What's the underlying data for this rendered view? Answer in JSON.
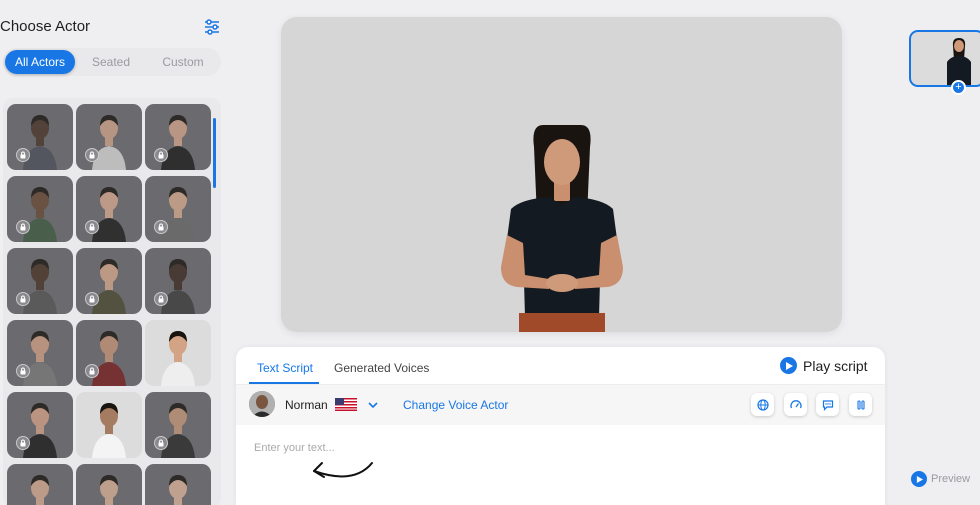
{
  "left_panel": {
    "title": "Choose Actor",
    "filter_icon": "sliders-icon",
    "tabs": [
      {
        "label": "All Actors",
        "active": true
      },
      {
        "label": "Seated",
        "active": false
      },
      {
        "label": "Custom",
        "active": false
      }
    ],
    "actors": [
      {
        "locked": true,
        "skin": "#4a3428",
        "cloth": "#4b4f58",
        "bg": "#6b6b6f"
      },
      {
        "locked": true,
        "skin": "#cfa48a",
        "cloth": "#d9d9d9",
        "bg": "#6b6b6f"
      },
      {
        "locked": true,
        "skin": "#d3a58a",
        "cloth": "#1b1b1b",
        "bg": "#6b6b6f"
      },
      {
        "locked": true,
        "skin": "#6a4a34",
        "cloth": "#3f5a40",
        "bg": "#6b6b6f"
      },
      {
        "locked": true,
        "skin": "#d8aa90",
        "cloth": "#1d1d1d",
        "bg": "#6b6b6f"
      },
      {
        "locked": true,
        "skin": "#d6ab8d",
        "cloth": "#6a6a6a",
        "bg": "#6b6b6f"
      },
      {
        "locked": true,
        "skin": "#4a3325",
        "cloth": "#555",
        "bg": "#6b6b6f"
      },
      {
        "locked": true,
        "skin": "#d7a88c",
        "cloth": "#4b4a32",
        "bg": "#6b6b6f"
      },
      {
        "locked": true,
        "skin": "#3d2a20",
        "cloth": "#3d3d3d",
        "bg": "#6b6b6f"
      },
      {
        "locked": true,
        "skin": "#d0a085",
        "cloth": "#7a7a7a",
        "bg": "#6b6b6f"
      },
      {
        "locked": true,
        "skin": "#c99579",
        "cloth": "#7a1e1e",
        "bg": "#6b6b6f"
      },
      {
        "locked": false,
        "skin": "#d2a384",
        "cloth": "#eeeeee",
        "bg": "#dcdcdc"
      },
      {
        "locked": true,
        "skin": "#d4a287",
        "cloth": "#1b1b1b",
        "bg": "#6b6b6f"
      },
      {
        "locked": false,
        "skin": "#a57c62",
        "cloth": "#f4f4f4",
        "bg": "#dcdcdc"
      },
      {
        "locked": true,
        "skin": "#c49777",
        "cloth": "#2a2a2a",
        "bg": "#6b6b6f"
      },
      {
        "locked": false,
        "skin": "#d7ab92",
        "cloth": "#4c5b78",
        "bg": "#6b6b6f"
      },
      {
        "locked": false,
        "skin": "#d9b096",
        "cloth": "#202020",
        "bg": "#6b6b6f"
      },
      {
        "locked": false,
        "skin": "#ddb39a",
        "cloth": "#e4e4e4",
        "bg": "#6b6b6f"
      }
    ]
  },
  "script_panel": {
    "tabs": [
      {
        "label": "Text Script",
        "active": true
      },
      {
        "label": "Generated Voices",
        "active": false
      }
    ],
    "play_label": "Play script",
    "voice": {
      "name": "Norman",
      "flag": "us-flag-icon",
      "change_label": "Change Voice Actor"
    },
    "action_icons": [
      "globe-icon",
      "speedometer-icon",
      "speech-bubble-icon",
      "pause-icon"
    ],
    "text_placeholder": "Enter your text...",
    "text_value": ""
  },
  "right_rail": {
    "preview_label": "Preview"
  },
  "colors": {
    "accent": "#1877e5",
    "panel_bg": "#e9e9ec",
    "page_bg": "#efeff1"
  }
}
